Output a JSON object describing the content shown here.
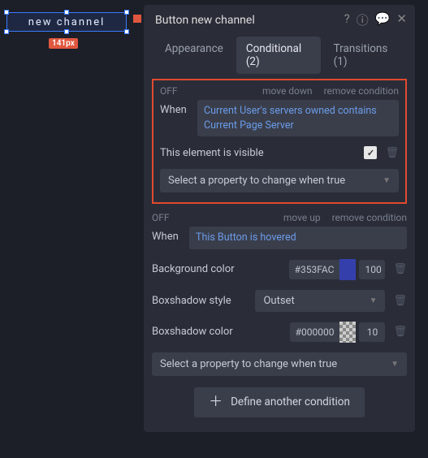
{
  "canvas": {
    "button_text": "new channel",
    "size_label": "141px"
  },
  "panel": {
    "title": "Button new channel",
    "tabs": {
      "appearance": "Appearance",
      "conditional": "Conditional (2)",
      "transitions": "Transitions (1)"
    }
  },
  "cond1": {
    "off": "OFF",
    "move": "move down",
    "remove": "remove condition",
    "when": "When",
    "expr": "Current User's servers owned contains Current Page Server",
    "visible_label": "This element is visible",
    "select_placeholder": "Select a property to change when true"
  },
  "cond2": {
    "off": "OFF",
    "move": "move up",
    "remove": "remove condition",
    "when": "When",
    "expr": "This Button is hovered",
    "bg_label": "Background color",
    "bg_hex": "#353FAC",
    "bg_opacity": "100",
    "shadow_style_label": "Boxshadow style",
    "shadow_style_value": "Outset",
    "shadow_color_label": "Boxshadow color",
    "shadow_hex": "#000000",
    "shadow_opacity": "10",
    "select_placeholder": "Select a property to change when true"
  },
  "define_btn": "Define another condition",
  "colors": {
    "bg_swatch": "#353FAC"
  }
}
